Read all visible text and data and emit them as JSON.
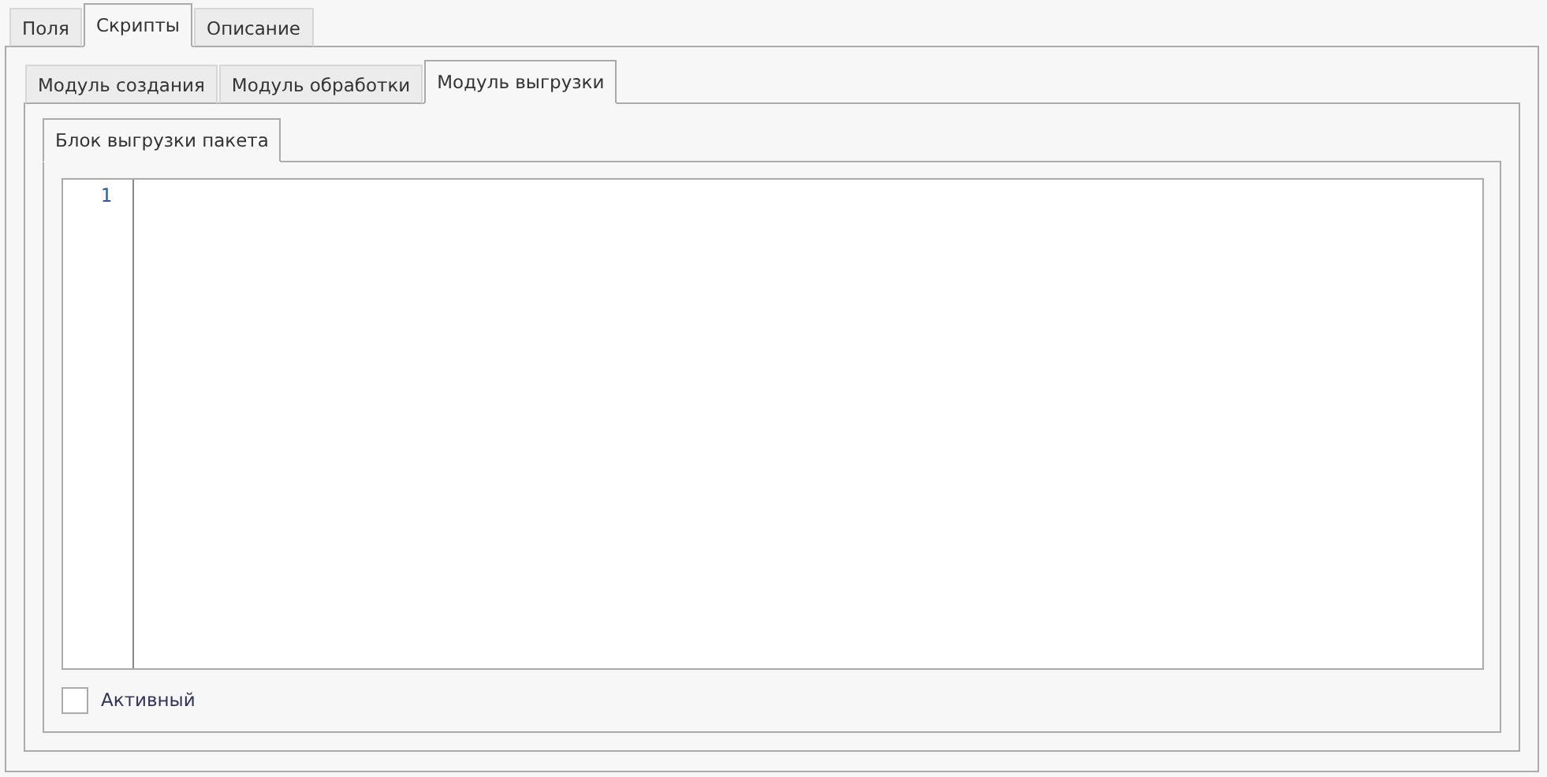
{
  "main_tabs": [
    {
      "label": "Поля",
      "selected": false
    },
    {
      "label": "Скрипты",
      "selected": true
    },
    {
      "label": "Описание",
      "selected": false
    }
  ],
  "module_tabs": [
    {
      "label": "Модуль создания",
      "selected": false
    },
    {
      "label": "Модуль обработки",
      "selected": false
    },
    {
      "label": "Модуль выгрузки",
      "selected": true
    }
  ],
  "block_tabs": [
    {
      "label": "Блок выгрузки пакета",
      "selected": true
    }
  ],
  "editor": {
    "line_numbers": [
      "1"
    ]
  },
  "active_checkbox": {
    "label": "Активный",
    "checked": false
  }
}
